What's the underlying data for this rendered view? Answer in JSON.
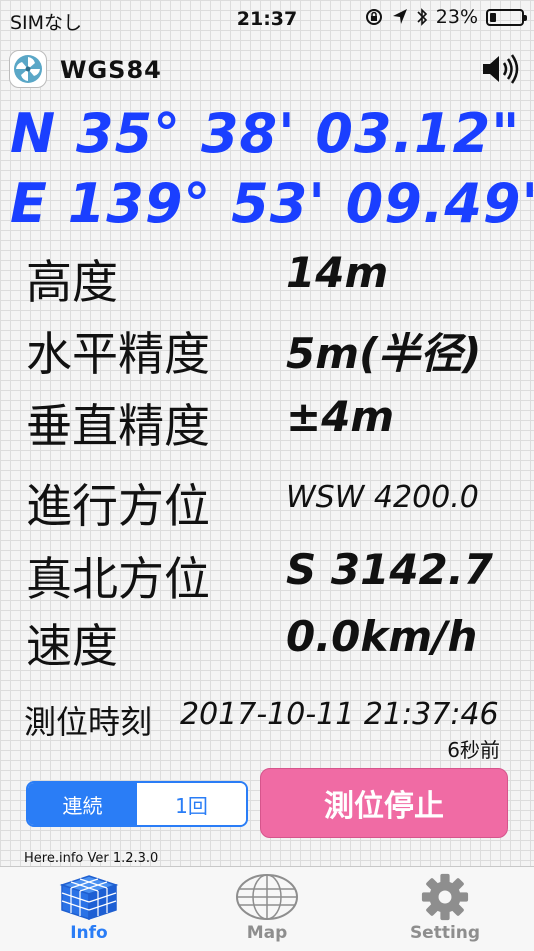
{
  "status_bar": {
    "carrier": "SIMなし",
    "time": "21:37",
    "battery": "23%",
    "battery_fraction": 0.23
  },
  "header": {
    "datum": "WGS84",
    "logo_icon": "pinwheel-icon",
    "sound_icon": "speaker-icon"
  },
  "coordinates": {
    "latitude": "N  35° 38' 03.12\"",
    "longitude": "E 139° 53' 09.49\""
  },
  "rows": [
    {
      "label": "高度",
      "value": "14m"
    },
    {
      "label": "水平精度",
      "value": "5m(半径)"
    },
    {
      "label": "垂直精度",
      "value": "±4m"
    },
    {
      "label": "進行方位",
      "value": "WSW 4200.0"
    },
    {
      "label": "真北方位",
      "value": "S 3142.7"
    },
    {
      "label": "速度",
      "value": "0.0km/h"
    }
  ],
  "fix_time": {
    "label": "測位時刻",
    "value": "2017-10-11 21:37:46",
    "ago": "6秒前"
  },
  "mode": {
    "options": [
      "連続",
      "1回"
    ],
    "selected": "連続"
  },
  "stop_button": "測位停止",
  "version": "Here.info Ver 1.2.3.0",
  "tabs": [
    {
      "label": "Info",
      "icon": "cube-grid-icon",
      "active": true
    },
    {
      "label": "Map",
      "icon": "globe-icon",
      "active": false
    },
    {
      "label": "Setting",
      "icon": "gear-icon",
      "active": false
    }
  ],
  "colors": {
    "accent": "#2a7df6",
    "coordinates": "#1a3fff",
    "stop_button": "#f06ba4"
  }
}
